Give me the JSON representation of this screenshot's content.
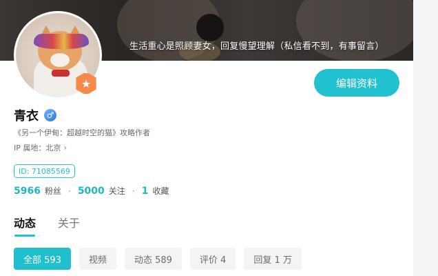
{
  "banner": {
    "motto": "生活重心是照顾妻女，回复慢望理解（私信看不到，有事留言）"
  },
  "profile": {
    "name": "青衣",
    "gender_symbol": "♂",
    "badge_symbol": "★",
    "bio": "《另一个伊甸：超越时空的猫》攻略作者",
    "location": "IP 属地：北京",
    "location_chevron": "›",
    "uid": "ID: 71085569",
    "edit_label": "编辑资料"
  },
  "stats": [
    {
      "value": "5966",
      "label": "粉丝"
    },
    {
      "value": "5000",
      "label": "关注"
    },
    {
      "value": "1",
      "label": "收藏"
    }
  ],
  "stat_separator": "·",
  "tabs": [
    {
      "label": "动态",
      "active": true
    },
    {
      "label": "关于",
      "active": false
    }
  ],
  "filters": [
    {
      "label": "全部 593",
      "active": true
    },
    {
      "label": "视频",
      "active": false
    },
    {
      "label": "动态 589",
      "active": false
    },
    {
      "label": "评价 4",
      "active": false
    },
    {
      "label": "回复 1 万",
      "active": false
    }
  ],
  "colors": {
    "accent": "#22c1cf",
    "badge": "#f58a4b",
    "gender": "#2b78e4"
  },
  "icons": {
    "gender": "male-icon",
    "badge": "star-badge-icon",
    "location": "chevron-right-icon"
  }
}
